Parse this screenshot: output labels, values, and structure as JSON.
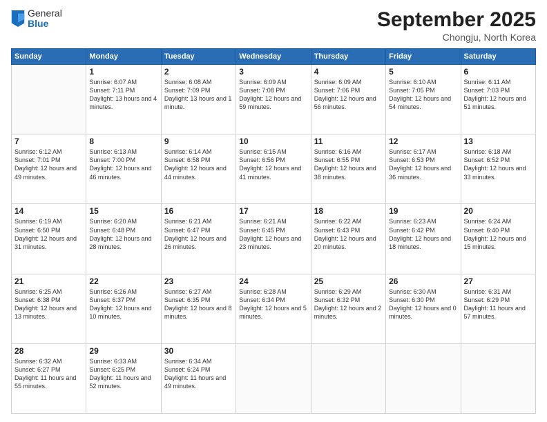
{
  "logo": {
    "general": "General",
    "blue": "Blue"
  },
  "title": "September 2025",
  "location": "Chongju, North Korea",
  "weekdays": [
    "Sunday",
    "Monday",
    "Tuesday",
    "Wednesday",
    "Thursday",
    "Friday",
    "Saturday"
  ],
  "weeks": [
    [
      {
        "day": null,
        "sunrise": null,
        "sunset": null,
        "daylight": null
      },
      {
        "day": 1,
        "sunrise": "6:07 AM",
        "sunset": "7:11 PM",
        "daylight": "13 hours and 4 minutes."
      },
      {
        "day": 2,
        "sunrise": "6:08 AM",
        "sunset": "7:09 PM",
        "daylight": "13 hours and 1 minute."
      },
      {
        "day": 3,
        "sunrise": "6:09 AM",
        "sunset": "7:08 PM",
        "daylight": "12 hours and 59 minutes."
      },
      {
        "day": 4,
        "sunrise": "6:09 AM",
        "sunset": "7:06 PM",
        "daylight": "12 hours and 56 minutes."
      },
      {
        "day": 5,
        "sunrise": "6:10 AM",
        "sunset": "7:05 PM",
        "daylight": "12 hours and 54 minutes."
      },
      {
        "day": 6,
        "sunrise": "6:11 AM",
        "sunset": "7:03 PM",
        "daylight": "12 hours and 51 minutes."
      }
    ],
    [
      {
        "day": 7,
        "sunrise": "6:12 AM",
        "sunset": "7:01 PM",
        "daylight": "12 hours and 49 minutes."
      },
      {
        "day": 8,
        "sunrise": "6:13 AM",
        "sunset": "7:00 PM",
        "daylight": "12 hours and 46 minutes."
      },
      {
        "day": 9,
        "sunrise": "6:14 AM",
        "sunset": "6:58 PM",
        "daylight": "12 hours and 44 minutes."
      },
      {
        "day": 10,
        "sunrise": "6:15 AM",
        "sunset": "6:56 PM",
        "daylight": "12 hours and 41 minutes."
      },
      {
        "day": 11,
        "sunrise": "6:16 AM",
        "sunset": "6:55 PM",
        "daylight": "12 hours and 38 minutes."
      },
      {
        "day": 12,
        "sunrise": "6:17 AM",
        "sunset": "6:53 PM",
        "daylight": "12 hours and 36 minutes."
      },
      {
        "day": 13,
        "sunrise": "6:18 AM",
        "sunset": "6:52 PM",
        "daylight": "12 hours and 33 minutes."
      }
    ],
    [
      {
        "day": 14,
        "sunrise": "6:19 AM",
        "sunset": "6:50 PM",
        "daylight": "12 hours and 31 minutes."
      },
      {
        "day": 15,
        "sunrise": "6:20 AM",
        "sunset": "6:48 PM",
        "daylight": "12 hours and 28 minutes."
      },
      {
        "day": 16,
        "sunrise": "6:21 AM",
        "sunset": "6:47 PM",
        "daylight": "12 hours and 26 minutes."
      },
      {
        "day": 17,
        "sunrise": "6:21 AM",
        "sunset": "6:45 PM",
        "daylight": "12 hours and 23 minutes."
      },
      {
        "day": 18,
        "sunrise": "6:22 AM",
        "sunset": "6:43 PM",
        "daylight": "12 hours and 20 minutes."
      },
      {
        "day": 19,
        "sunrise": "6:23 AM",
        "sunset": "6:42 PM",
        "daylight": "12 hours and 18 minutes."
      },
      {
        "day": 20,
        "sunrise": "6:24 AM",
        "sunset": "6:40 PM",
        "daylight": "12 hours and 15 minutes."
      }
    ],
    [
      {
        "day": 21,
        "sunrise": "6:25 AM",
        "sunset": "6:38 PM",
        "daylight": "12 hours and 13 minutes."
      },
      {
        "day": 22,
        "sunrise": "6:26 AM",
        "sunset": "6:37 PM",
        "daylight": "12 hours and 10 minutes."
      },
      {
        "day": 23,
        "sunrise": "6:27 AM",
        "sunset": "6:35 PM",
        "daylight": "12 hours and 8 minutes."
      },
      {
        "day": 24,
        "sunrise": "6:28 AM",
        "sunset": "6:34 PM",
        "daylight": "12 hours and 5 minutes."
      },
      {
        "day": 25,
        "sunrise": "6:29 AM",
        "sunset": "6:32 PM",
        "daylight": "12 hours and 2 minutes."
      },
      {
        "day": 26,
        "sunrise": "6:30 AM",
        "sunset": "6:30 PM",
        "daylight": "12 hours and 0 minutes."
      },
      {
        "day": 27,
        "sunrise": "6:31 AM",
        "sunset": "6:29 PM",
        "daylight": "11 hours and 57 minutes."
      }
    ],
    [
      {
        "day": 28,
        "sunrise": "6:32 AM",
        "sunset": "6:27 PM",
        "daylight": "11 hours and 55 minutes."
      },
      {
        "day": 29,
        "sunrise": "6:33 AM",
        "sunset": "6:25 PM",
        "daylight": "11 hours and 52 minutes."
      },
      {
        "day": 30,
        "sunrise": "6:34 AM",
        "sunset": "6:24 PM",
        "daylight": "11 hours and 49 minutes."
      },
      {
        "day": null
      },
      {
        "day": null
      },
      {
        "day": null
      },
      {
        "day": null
      }
    ]
  ]
}
